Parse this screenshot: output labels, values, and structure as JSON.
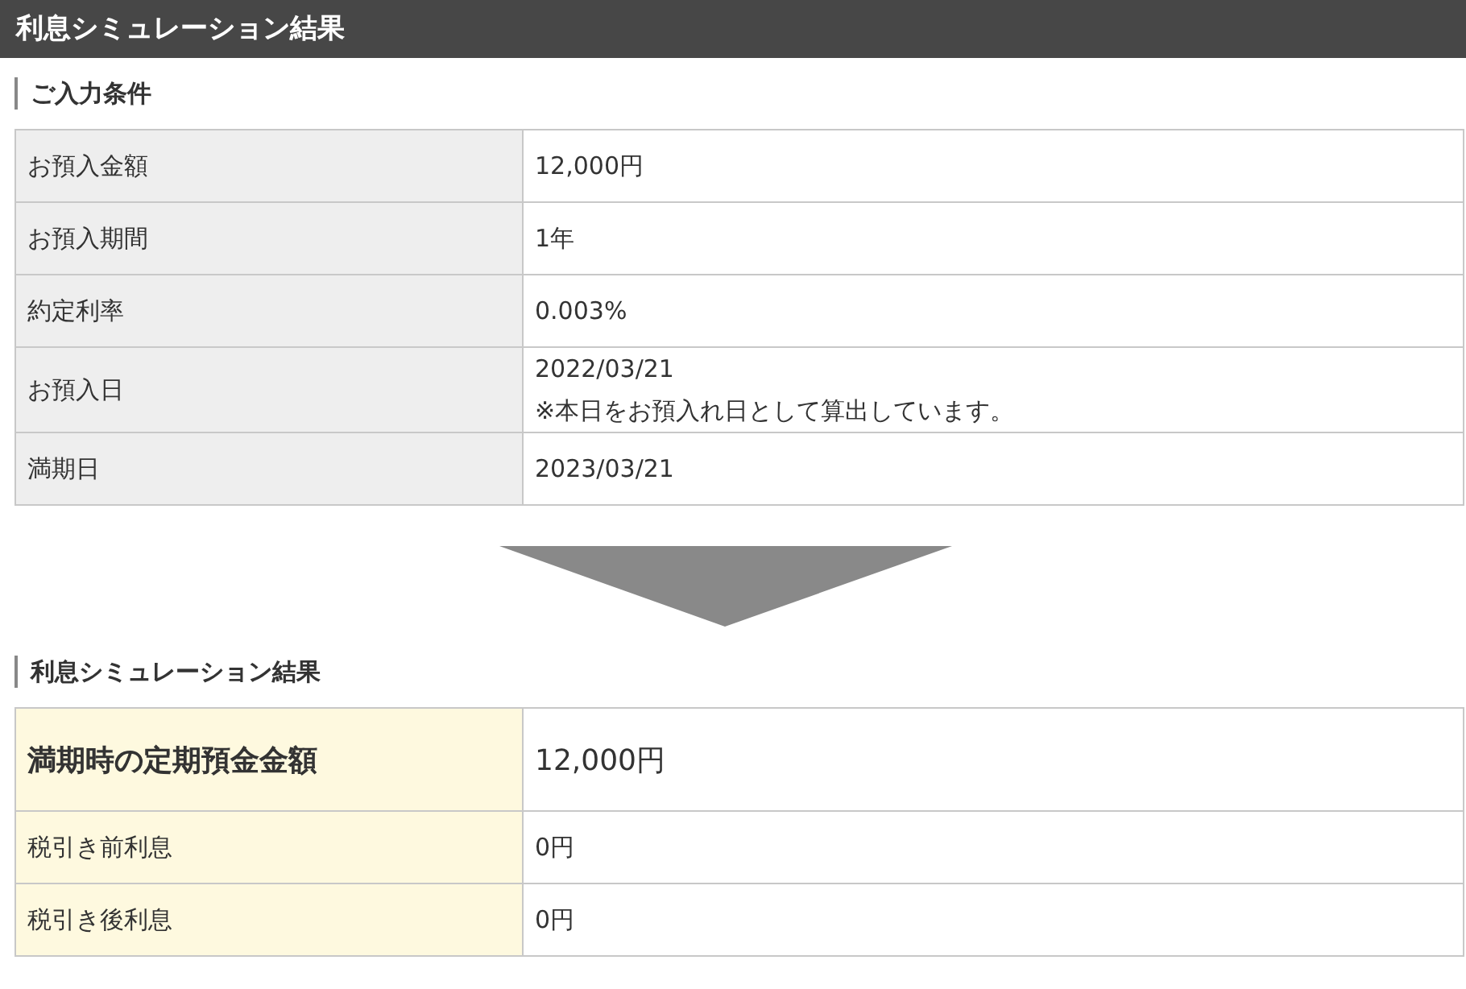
{
  "title": "利息シミュレーション結果",
  "input_section": {
    "heading": "ご入力条件",
    "rows": [
      {
        "label": "お預入金額",
        "values": [
          "12,000円"
        ]
      },
      {
        "label": "お預入期間",
        "values": [
          "1年"
        ]
      },
      {
        "label": "約定利率",
        "values": [
          "0.003%"
        ]
      },
      {
        "label": "お預入日",
        "values": [
          "2022/03/21",
          "※本日をお預入れ日として算出しています。"
        ]
      },
      {
        "label": "満期日",
        "values": [
          "2023/03/21"
        ]
      }
    ]
  },
  "result_section": {
    "heading": "利息シミュレーション結果",
    "rows": [
      {
        "kind": "total",
        "label": "満期時の定期預金金額",
        "value": "12,000円"
      },
      {
        "kind": "normal",
        "label": "税引き前利息",
        "value": "0円"
      },
      {
        "kind": "normal",
        "label": "税引き後利息",
        "value": "0円"
      }
    ]
  }
}
